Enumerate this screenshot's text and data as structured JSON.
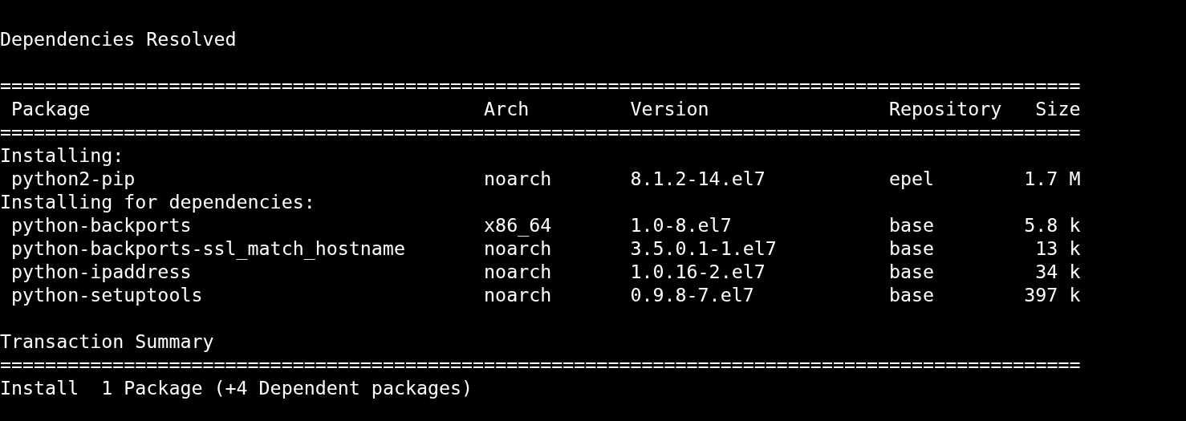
{
  "heading": "Dependencies Resolved",
  "table": {
    "rule_top": "================================================================================================",
    "columns": [
      "Package",
      "Arch",
      "Version",
      "Repository",
      "Size"
    ],
    "rule_header": "================================================================================================",
    "rows": [
      {
        "kind": "group",
        "label": "Installing:"
      },
      {
        "kind": "package",
        "cells": [
          "python2-pip",
          "noarch",
          "8.1.2-14.el7",
          "epel",
          "1.7 M"
        ]
      },
      {
        "kind": "group",
        "label": "Installing for dependencies:"
      },
      {
        "kind": "package",
        "cells": [
          "python-backports",
          "x86_64",
          "1.0-8.el7",
          "base",
          "5.8 k"
        ]
      },
      {
        "kind": "package",
        "cells": [
          "python-backports-ssl_match_hostname",
          "noarch",
          "3.5.0.1-1.el7",
          "base",
          "13 k"
        ]
      },
      {
        "kind": "package",
        "cells": [
          "python-ipaddress",
          "noarch",
          "1.0.16-2.el7",
          "base",
          "34 k"
        ]
      },
      {
        "kind": "package",
        "cells": [
          "python-setuptools",
          "noarch",
          "0.9.8-7.el7",
          "base",
          "397 k"
        ]
      }
    ]
  },
  "summary": {
    "title": "Transaction Summary",
    "rule": "================================================================================================",
    "line": "Install  1 Package (+4 Dependent packages)"
  }
}
